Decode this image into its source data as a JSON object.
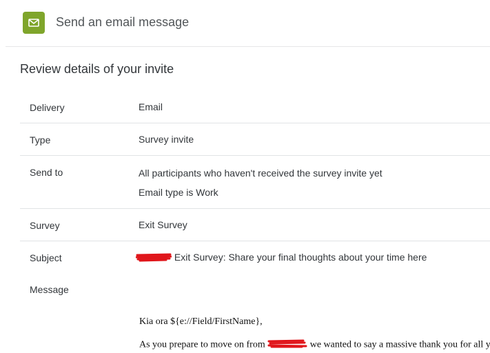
{
  "header": {
    "icon": "envelope-icon",
    "icon_color": "#7fa52b",
    "title": "Send an email message"
  },
  "review": {
    "title": "Review details of your invite",
    "rows": [
      {
        "label": "Delivery",
        "value": "Email"
      },
      {
        "label": "Type",
        "value": "Survey invite"
      },
      {
        "label": "Send to",
        "value": "All participants who haven't received the survey invite yet",
        "value2": "Email type is Work"
      },
      {
        "label": "Survey",
        "value": "Exit Survey"
      },
      {
        "label": "Subject",
        "value": "Exit Survey: Share your final thoughts about your time here"
      },
      {
        "label": "Message"
      }
    ]
  },
  "message": {
    "greeting": "Kia ora ${e://Field/FirstName},",
    "body_start": "As you prepare to move on from",
    "body_end": "we wanted to say a massive thank you for all you"
  },
  "colors": {
    "accent": "#7fa52b",
    "redaction": "#e0161b"
  }
}
